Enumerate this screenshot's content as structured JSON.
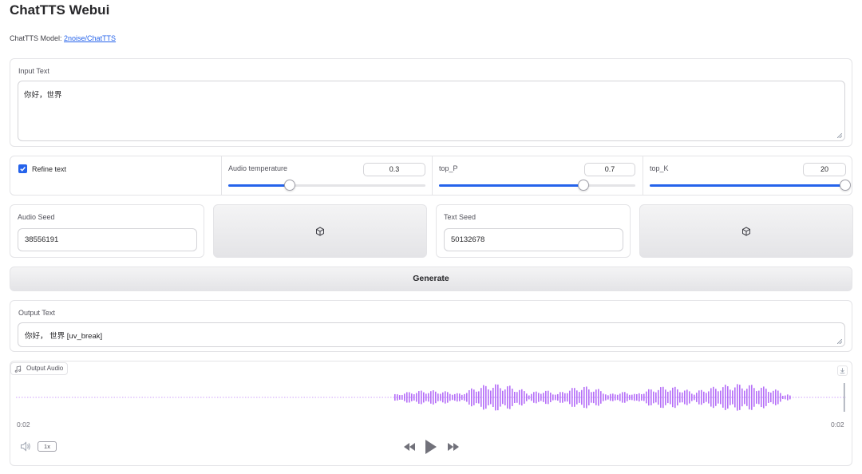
{
  "app": {
    "title": "ChatTTS Webui",
    "model_prefix": "ChatTTS Model: ",
    "model_link": "2noise/ChatTTS"
  },
  "input_text": {
    "label": "Input Text",
    "value": "你好，世界"
  },
  "settings": {
    "refine_label": "Refine text",
    "refine_checked": true,
    "audio_temperature": {
      "label": "Audio temperature",
      "value": "0.3"
    },
    "top_p": {
      "label": "top_P",
      "value": "0.7"
    },
    "top_k": {
      "label": "top_K",
      "value": "20"
    }
  },
  "audio_seed": {
    "label": "Audio Seed",
    "value": "38556191",
    "dice_icon": "dice-icon"
  },
  "text_seed": {
    "label": "Text Seed",
    "value": "50132678",
    "dice_icon": "dice-icon"
  },
  "generate_label": "Generate",
  "output_text": {
    "label": "Output Text",
    "value": "你好， 世界 [uv_break]"
  },
  "output_audio": {
    "label": "Output Audio",
    "current_time": "0:02",
    "duration": "0:02",
    "speed": "1x",
    "wave_color": "#a855f7",
    "icons": [
      "music-note-icon",
      "download-icon",
      "volume-icon",
      "rewind-icon",
      "play-icon",
      "fast-forward-icon"
    ]
  },
  "colors": {
    "accent": "#2563eb",
    "waveform": "#a855f7"
  }
}
